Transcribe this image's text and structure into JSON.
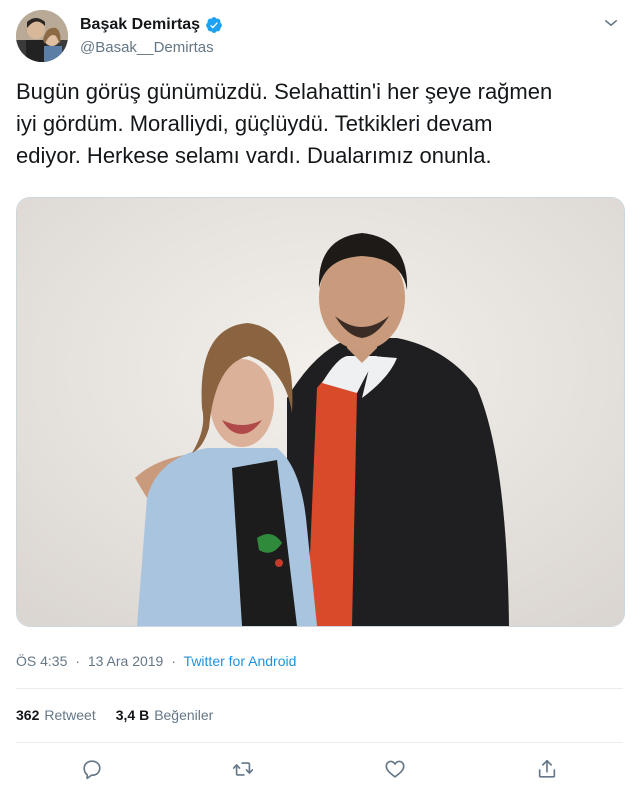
{
  "author": {
    "display_name": "Başak Demirtaş",
    "handle": "@Basak__Demirtas",
    "verified": true,
    "avatar_icon": "profile-photo"
  },
  "tweet": {
    "text": "Bugün görüş günümüzdü. Selahattin'i her şeye rağmen\niyi gördüm. Moralliydi, güçlüydü. Tetkikleri devam\nediyor. Herkese selamı vardı. Dualarımız onunla.",
    "time": "ÖS 4:35",
    "date": "13 Ara 2019",
    "separator": "·",
    "source": "Twitter for Android"
  },
  "stats": {
    "retweets_count": "362",
    "retweets_label": "Retweet",
    "likes_count": "3,4 B",
    "likes_label": "Beğeniler"
  },
  "actions": [
    "reply-icon",
    "retweet-icon",
    "like-icon",
    "share-icon"
  ],
  "colors": {
    "text": "#14171a",
    "muted": "#657786",
    "link": "#1b95e0",
    "verified": "#1da1f2",
    "divider": "#e6ecf0"
  }
}
